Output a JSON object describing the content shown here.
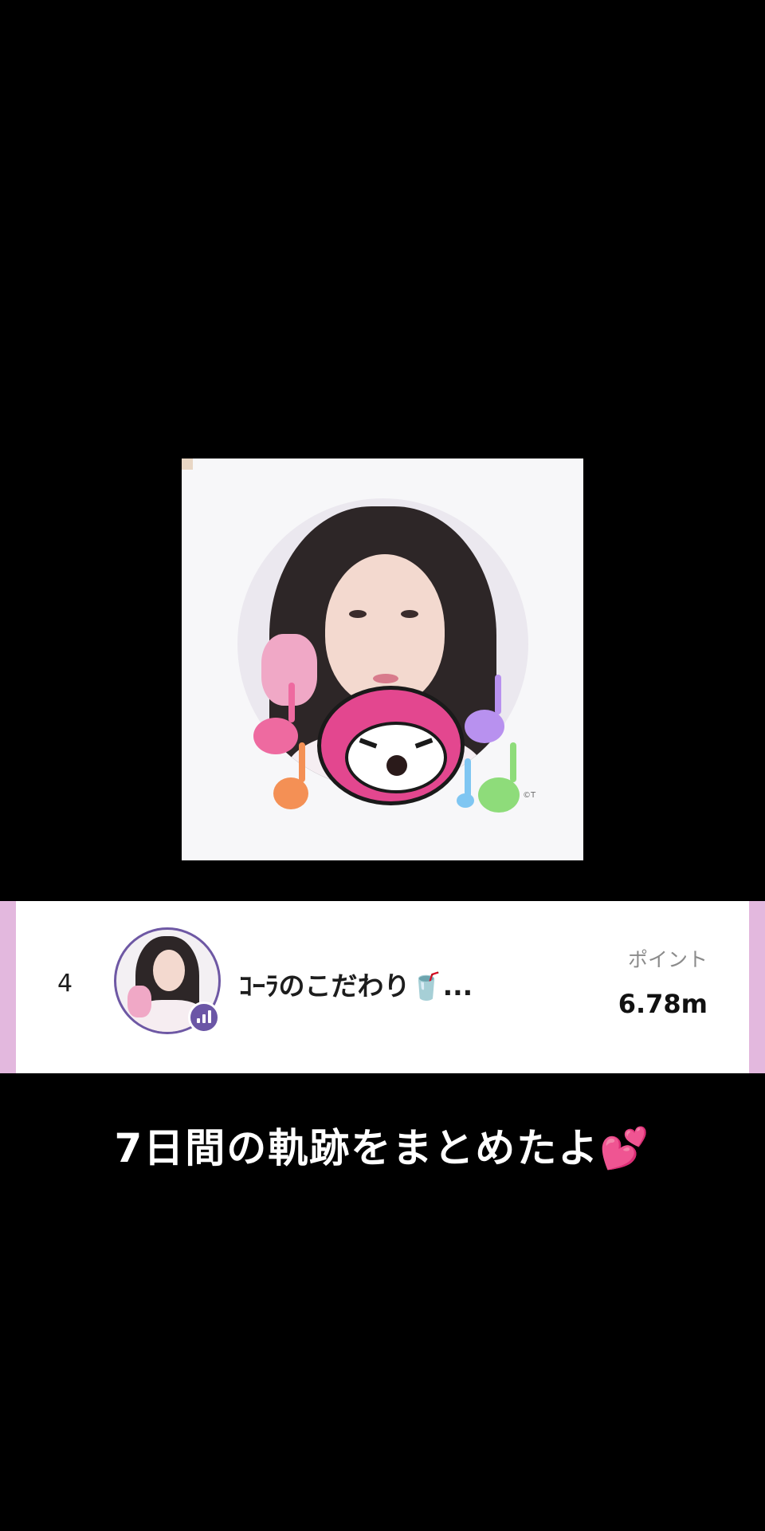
{
  "profile_image": {
    "copyright": "©T"
  },
  "ranking": {
    "rank": "4",
    "name": "ｺｰﾗのこだわり🥤...",
    "points_label": "ポイント",
    "points_value": "6.78m",
    "live_icon": "live-bars-icon"
  },
  "caption": {
    "text": "7日間の軌跡をまとめたよ💕"
  },
  "colors": {
    "background": "#000000",
    "side_stripe": "#e3b8de",
    "badge": "#6b56a6",
    "mascot": "#e3478f"
  }
}
